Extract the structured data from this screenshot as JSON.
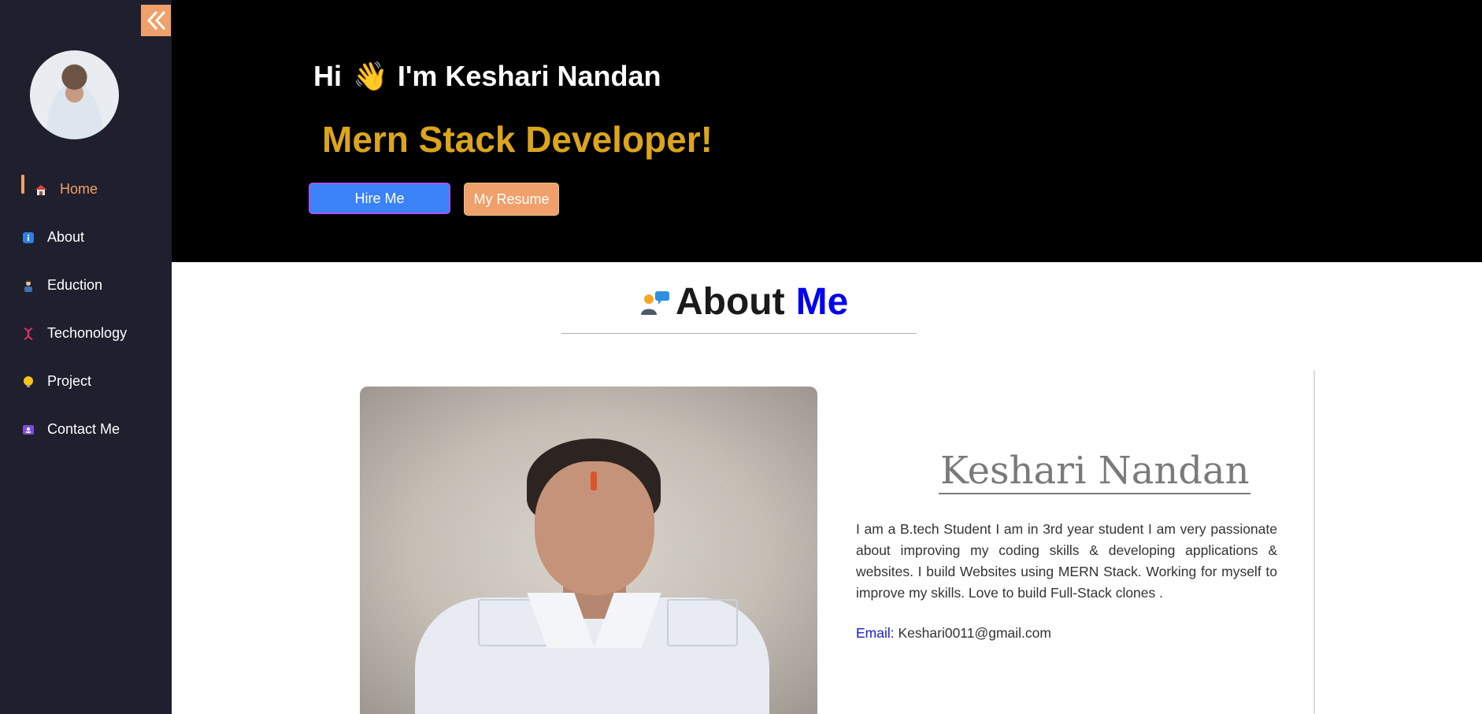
{
  "sidebar": {
    "collapse_icon": "double-chevron-left-icon",
    "items": [
      {
        "label": "Home",
        "icon": "house-icon"
      },
      {
        "label": "About",
        "icon": "info-icon"
      },
      {
        "label": "Eduction",
        "icon": "student-icon"
      },
      {
        "label": "Techonology",
        "icon": "dna-icon"
      },
      {
        "label": "Project",
        "icon": "lightbulb-icon"
      },
      {
        "label": "Contact Me",
        "icon": "contact-card-icon"
      }
    ]
  },
  "hero": {
    "greeting_hi": "Hi",
    "greeting_emoji": "👋",
    "greeting_name": "I'm Keshari Nandan",
    "role": "Mern Stack Developer!",
    "hire_button": "Hire Me",
    "resume_button": "My Resume"
  },
  "about": {
    "title_part1": "About",
    "title_part2": "Me",
    "name": "Keshari Nandan",
    "bio": "I am a B.tech Student I am in 3rd year student I am very passionate about improving my coding skills & developing applications & websites. I build Websites using MERN Stack. Working for myself to improve my skills. Love to build Full-Stack clones .",
    "email_label": "Email:",
    "email_value": "Keshari0011@gmail.com"
  },
  "colors": {
    "sidebar_bg": "#1f1f2e",
    "accent_orange": "#f0a06a",
    "role_gold": "#dba51c",
    "hire_blue": "#3b82f6",
    "me_blue": "#0000ee"
  }
}
